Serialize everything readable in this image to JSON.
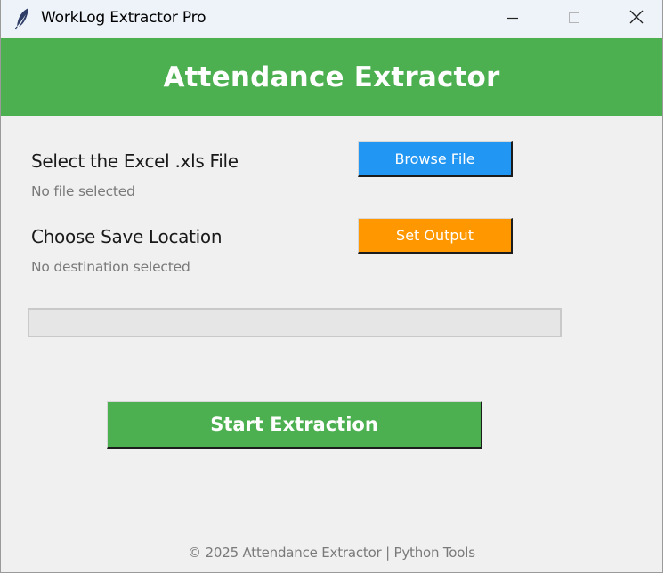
{
  "window": {
    "title": "WorkLog Extractor Pro",
    "icon": "feather-icon",
    "controls": [
      "minimize-icon",
      "maximize-icon",
      "close-icon"
    ]
  },
  "header": {
    "title": "Attendance Extractor",
    "background_color": "#4caf50"
  },
  "input_file": {
    "label": "Select the Excel .xls File",
    "status": "No file selected",
    "button_label": "Browse File",
    "button_color": "#2196f3"
  },
  "output_location": {
    "label": "Choose Save Location",
    "status": "No destination selected",
    "button_label": "Set Output",
    "button_color": "#ff9800"
  },
  "progress": {
    "value_percent": 0
  },
  "actions": {
    "start_label": "Start Extraction",
    "start_color": "#4caf50"
  },
  "footer": {
    "text": "© 2025 Attendance Extractor | Python Tools"
  }
}
